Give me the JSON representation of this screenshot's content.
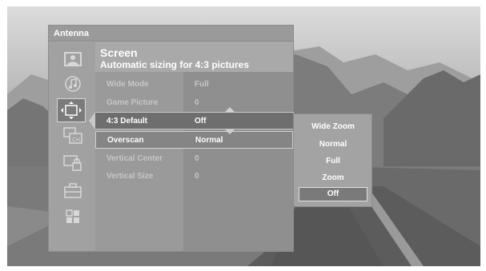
{
  "panel": {
    "title": "Antenna"
  },
  "heading": {
    "title": "Screen",
    "subtitle": "Automatic sizing for 4:3 pictures"
  },
  "sidebar": {
    "icons": [
      "picture-icon",
      "sound-icon",
      "screen-icon",
      "channel-icon",
      "lock-icon",
      "toolbox-icon",
      "setup-icon"
    ],
    "active_index": 2
  },
  "settings": [
    {
      "label": "Wide Mode",
      "value": "Full",
      "state": "dim"
    },
    {
      "label": "Game Picture",
      "value": "0",
      "state": "dim"
    },
    {
      "label": "4:3 Default",
      "value": "Off",
      "state": "selected"
    },
    {
      "label": "Overscan",
      "value": "Normal",
      "state": "bright"
    },
    {
      "label": "Vertical Center",
      "value": "0",
      "state": "dim"
    },
    {
      "label": "Vertical Size",
      "value": "0",
      "state": "dim"
    }
  ],
  "dropdown": {
    "options": [
      "Wide Zoom",
      "Normal",
      "Full",
      "Zoom",
      "Off"
    ],
    "current": "Off"
  }
}
